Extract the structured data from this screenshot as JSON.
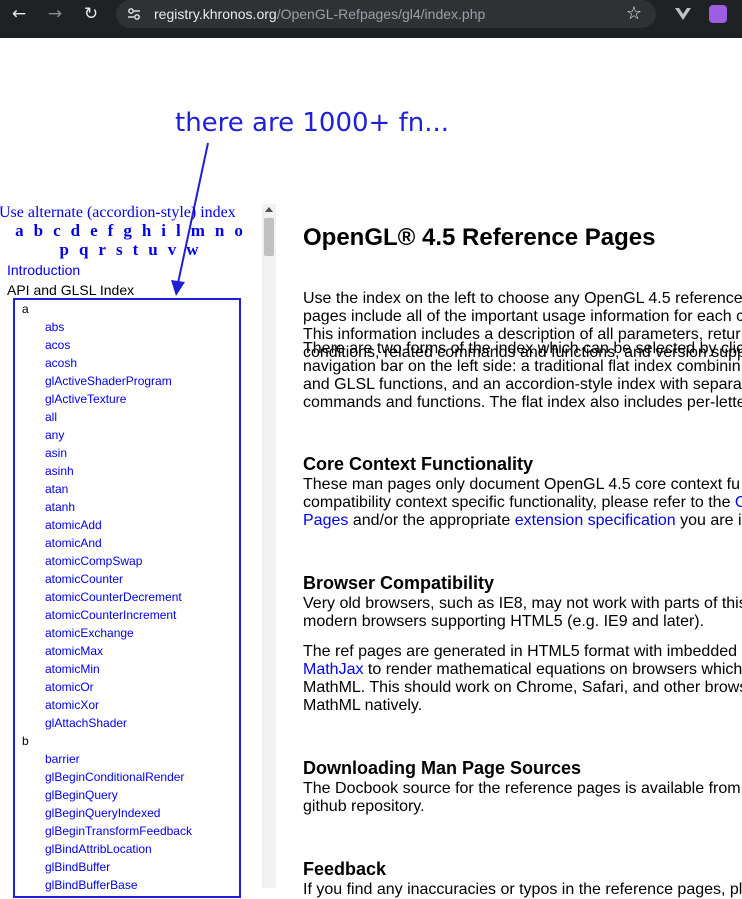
{
  "browser": {
    "url_host": "registry.khronos.org",
    "url_path": "/OpenGL-Refpages/gl4/index.php"
  },
  "annotation": {
    "text": "there are 1000+ fn..."
  },
  "left_index": {
    "alternate_link": "Use alternate (accordion-style) index",
    "letters_row1": [
      "a",
      "b",
      "c",
      "d",
      "e",
      "f",
      "g",
      "h",
      "i",
      "l",
      "m",
      "n",
      "o"
    ],
    "letters_row2": [
      "p",
      "q",
      "r",
      "s",
      "t",
      "u",
      "v",
      "w"
    ],
    "introduction": "Introduction",
    "api_title": "API and GLSL Index",
    "groups": [
      {
        "letter": "a",
        "items": [
          "abs",
          "acos",
          "acosh",
          "glActiveShaderProgram",
          "glActiveTexture",
          "all",
          "any",
          "asin",
          "asinh",
          "atan",
          "atanh",
          "atomicAdd",
          "atomicAnd",
          "atomicCompSwap",
          "atomicCounter",
          "atomicCounterDecrement",
          "atomicCounterIncrement",
          "atomicExchange",
          "atomicMax",
          "atomicMin",
          "atomicOr",
          "atomicXor",
          "glAttachShader"
        ]
      },
      {
        "letter": "b",
        "items": [
          "barrier",
          "glBeginConditionalRender",
          "glBeginQuery",
          "glBeginQueryIndexed",
          "glBeginTransformFeedback",
          "glBindAttribLocation",
          "glBindBuffer",
          "glBindBufferBase"
        ]
      }
    ]
  },
  "main": {
    "title": "OpenGL® 4.5 Reference Pages",
    "intro": [
      "Use the index on the left to choose any OpenGL 4.5 reference",
      "pages include all of the important usage information for each c",
      "This information includes a description of all parameters, retur",
      "conditions, related commands and functions, and version supp"
    ],
    "forms": [
      "There are two forms of the index which can be selected by clic",
      "navigation bar on the left side: a traditional flat index combinin",
      "and GLSL functions, and an accordion-style index with separa",
      "commands and functions. The flat index also includes per-lette"
    ],
    "core_heading": "Core Context Functionality",
    "core_line1": "These man pages only document OpenGL 4.5 core context fu",
    "core_line2_a": "compatibility context specific functionality, please refer to the ",
    "core_line2_link": "C",
    "core_line3_link1": "Pages",
    "core_line3_mid": " and/or the appropriate ",
    "core_line3_link2": "extension specification",
    "core_line3_end": " you are i",
    "browser_heading": "Browser Compatibility",
    "browser_lines": [
      "Very old browsers, such as IE8, may not work with parts of this",
      "modern browsers supporting HTML5 (e.g. IE9 and later)."
    ],
    "html5_line1": "The ref pages are generated in HTML5 format with imbedded",
    "html5_line2_link": "MathJax",
    "html5_line2_rest": " to render mathematical equations on browsers which",
    "html5_line3": "MathML. This should work on Chrome, Safari, and other brows",
    "html5_line4": "MathML natively.",
    "download_heading": "Downloading Man Page Sources",
    "download_lines": [
      "The Docbook source for the reference pages is available from",
      "github repository."
    ],
    "feedback_heading": "Feedback",
    "feedback_line": "If you find any inaccuracies or typos in the reference pages, pl"
  }
}
